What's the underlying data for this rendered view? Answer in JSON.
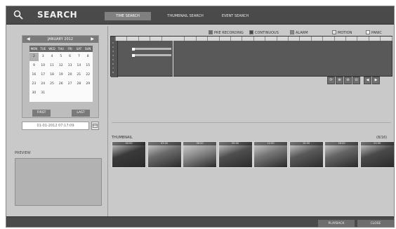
{
  "header": {
    "title": "SEARCH",
    "icon": "search-icon",
    "tabs": [
      "TIME SEARCH",
      "THUMBNAIL SEARCH",
      "EVENT SEARCH"
    ],
    "active_tab": 0
  },
  "calendar": {
    "month_title": "JANUARY 2012",
    "weekdays": [
      "MON",
      "TUE",
      "WED",
      "THU",
      "FRI",
      "SAT",
      "SUN"
    ],
    "days": [
      "2",
      "3",
      "4",
      "5",
      "6",
      "7",
      "8",
      "9",
      "10",
      "11",
      "12",
      "13",
      "14",
      "15",
      "16",
      "17",
      "18",
      "19",
      "20",
      "21",
      "22",
      "23",
      "24",
      "25",
      "26",
      "27",
      "28",
      "29",
      "30",
      "31"
    ],
    "selected_day": "2",
    "first_label": "FIRST",
    "last_label": "LAST"
  },
  "datetime": {
    "value": "01-01-2012 07:17:09"
  },
  "preview": {
    "label": "PREVIEW"
  },
  "legend": {
    "items": [
      {
        "label": "PRE RECORDING",
        "color": "#6f6f6f"
      },
      {
        "label": "CONTINUOUS",
        "color": "#4a4a4a"
      },
      {
        "label": "ALARM",
        "color": "#8a8a8a"
      },
      {
        "label": "MOTION",
        "color": "#e4e4e4"
      },
      {
        "label": "PANIC",
        "color": "#f2f2f2"
      }
    ]
  },
  "timeline": {
    "channels": [
      "1",
      "2",
      "3",
      "4",
      "5",
      "6",
      "7",
      "8"
    ]
  },
  "controls": {
    "icons": [
      "refresh-icon",
      "zoom-in-icon",
      "zoom-out-icon",
      "fit-icon",
      "prev-icon",
      "next-icon"
    ]
  },
  "thumbnails": {
    "label": "THUMBNAIL",
    "count": "(8/16)",
    "times": [
      "00:00",
      "03:00",
      "06:00",
      "09:00",
      "12:00",
      "15:00",
      "18:00",
      "21:00"
    ],
    "tones": [
      "#3a3a3a",
      "#6b6b6b",
      "#8d8d8d",
      "#4f4f4f",
      "#777777",
      "#5a5a5a",
      "#666666",
      "#4a4a4a"
    ]
  },
  "bottombar": {
    "playback_label": "PLAYBACK",
    "close_label": "CLOSE"
  }
}
